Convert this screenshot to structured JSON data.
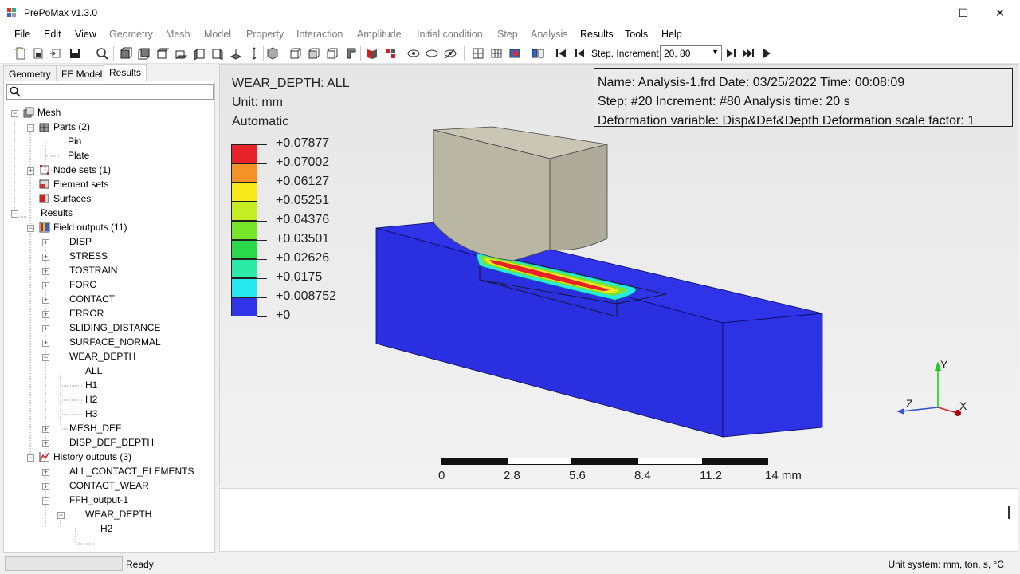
{
  "window": {
    "title": "PrePoMax v1.3.0",
    "minimize": "—",
    "maximize": "☐",
    "close": "✕"
  },
  "menu": [
    "File",
    "Edit",
    "View",
    "Geometry",
    "Mesh",
    "Model",
    "Property",
    "Interaction",
    "Amplitude",
    "Initial condition",
    "Step",
    "Analysis",
    "Results",
    "Tools",
    "Help"
  ],
  "toolbar": {
    "step_label": "Step, Increment",
    "step_value": "20, 80"
  },
  "tabs": [
    "Geometry",
    "FE Model",
    "Results"
  ],
  "tree": {
    "mesh": "Mesh",
    "parts": "Parts (2)",
    "pin": "Pin",
    "plate": "Plate",
    "node_sets": "Node sets (1)",
    "element_sets": "Element sets",
    "surfaces": "Surfaces",
    "results": "Results",
    "field_outputs": "Field outputs (11)",
    "disp": "DISP",
    "stress": "STRESS",
    "tostrain": "TOSTRAIN",
    "forc": "FORC",
    "contact": "CONTACT",
    "error": "ERROR",
    "sliding": "SLIDING_DISTANCE",
    "surface_normal": "SURFACE_NORMAL",
    "wear_depth": "WEAR_DEPTH",
    "all": "ALL",
    "h1": "H1",
    "h2": "H2",
    "h3": "H3",
    "mesh_def": "MESH_DEF",
    "disp_def_depth": "DISP_DEF_DEPTH",
    "history_outputs": "History outputs (3)",
    "all_contact": "ALL_CONTACT_ELEMENTS",
    "contact_wear": "CONTACT_WEAR",
    "ffh": "FFH_output-1",
    "ffh_wear": "WEAR_DEPTH",
    "ffh_h2": "H2"
  },
  "viewport": {
    "field": "WEAR_DEPTH: ALL",
    "unit": "Unit: mm",
    "mode": "Automatic",
    "info": {
      "line1": "Name: Analysis-1.frd   Date: 03/25/2022   Time: 00:08:09",
      "line2": "Step: #20   Increment: #80   Analysis time: 20 s",
      "line3": "Deformation variable: Disp&Def&Depth   Deformation scale factor: 1"
    },
    "legend": {
      "values": [
        "+0.07877",
        "+0.07002",
        "+0.06127",
        "+0.05251",
        "+0.04376",
        "+0.03501",
        "+0.02626",
        "+0.0175",
        "+0.008752",
        "+0"
      ],
      "colors": [
        "#e8222a",
        "#f39226",
        "#f7e91b",
        "#c7ee22",
        "#77e52a",
        "#2ad84a",
        "#2eeaa9",
        "#28e8ef",
        "#2596ee",
        "#2f34e8"
      ]
    },
    "scale": {
      "labels": [
        "0",
        "2.8",
        "5.6",
        "8.4",
        "11.2",
        "14 mm"
      ]
    },
    "axes": {
      "x": "X",
      "y": "Y",
      "z": "Z"
    }
  },
  "status": {
    "text": "Ready",
    "units": "Unit system: mm, ton, s, °C"
  }
}
